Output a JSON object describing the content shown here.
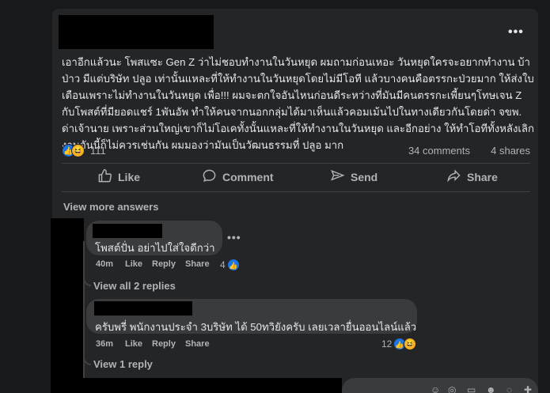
{
  "post": {
    "more_glyph": "•••",
    "text": "เอาอีกแล้วนะ โพสแซะ Gen Z ว่าไม่ชอบทำงานในวันหยุด ผมถามก่อนเหอะ วันหยุดใครจะอยากทำงาน บ้าป่าว มีแต่บริษัท ปลูอ เท่านั้นแหละที่ให้ทำงานในวันหยุดโดยไม่มีโอที แล้วบางคนคือตรรกะป่วยมาก ให้ส่งใบเตือนเพราะไม่ทำงานในวันหยุด เพื่อ!!! ผมจะตกใจอันไหนก่อนดีระหว่างที่มันมีคนตรรกะเพี้ยนๆโทษเจน Z กับโพสต์ที่มียอดแชร์ 1พันอัพ ทำให้คนจากนอกกลุ่มได้มาเห็นแล้วคอมเม้นไปในทางเดียวกันโดยด่า จขพ. ด่าเจ้านาย เพราะส่วนใหญ่เขาก็ไม่โอเคทั้งนั้นแหละที่ให้ทำงานในวันหยุด และอีกอย่าง ให้ทำโอทีทั้งหลังเลิกงานอันนี้ก็ไม่ควรเช่นกัน ผมมองว่ามันเป็นวัฒนธรรมที่ ปลูอ มาก",
    "reactions_count": "111",
    "comments_count": "34 comments",
    "shares_count": "4 shares"
  },
  "actions": {
    "like": "Like",
    "comment": "Comment",
    "send": "Send",
    "share": "Share"
  },
  "view_more_answers": "View more answers",
  "comments": [
    {
      "text": "โพสต์ปั่น อย่าไปใส่ใจดีกว่า",
      "time": "40m",
      "like": "Like",
      "reply": "Reply",
      "share": "Share",
      "reaction_count": "4",
      "more_glyph": "•••",
      "view_replies": "View all 2 replies"
    },
    {
      "text": "ครับพรี่ พนักงานประจำ 3บริษัท ได้ 50ทวิยังครับ เลยเวลายื่นออนไลน์แล้ว",
      "time": "36m",
      "like": "Like",
      "reply": "Reply",
      "share": "Share",
      "reaction_count": "12",
      "view_replies": "View 1 reply"
    }
  ],
  "icons": {
    "like_reaction": "👍",
    "haha_reaction": "😆",
    "like_action": "thumbs-up-icon",
    "comment_action": "speech-bubble-icon",
    "send_action": "paper-plane-icon",
    "share_action": "share-arrow-icon"
  },
  "colors": {
    "background": "#18191a",
    "card": "#242526",
    "bubble": "#3a3b3c",
    "text_primary": "#e4e6eb",
    "text_secondary": "#b0b3b8",
    "like_blue": "#1b74e4",
    "haha_yellow": "#f7b125"
  }
}
